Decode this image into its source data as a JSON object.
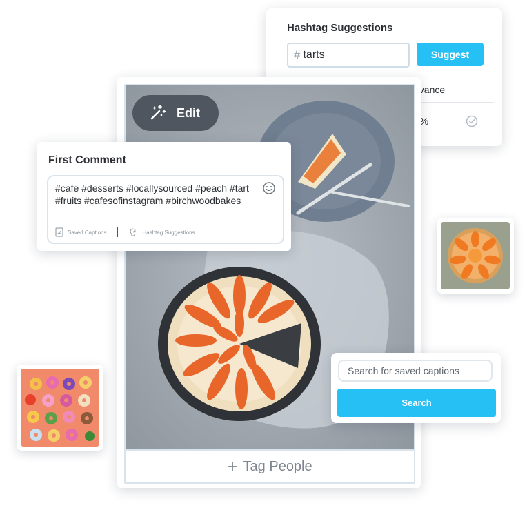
{
  "hashtag_panel": {
    "title": "Hashtag Suggestions",
    "input_value": "tarts",
    "input_prefix": "#",
    "suggest_label": "Suggest",
    "column_header_partial": "evance",
    "row_value_partial": "%"
  },
  "post": {
    "edit_label": "Edit",
    "tag_people_label": "Tag People"
  },
  "first_comment": {
    "title": "First Comment",
    "text": "#cafe #desserts #locallysourced #peach #tart #fruits #cafesofinstagram #birchwoodbakes",
    "saved_captions_label": "Saved Captions",
    "hashtag_suggestions_label": "Hashtag Suggestions"
  },
  "search_panel": {
    "placeholder": "Search for saved captions",
    "button_label": "Search"
  },
  "colors": {
    "accent": "#27c0f5",
    "edit_button": "#4f5660",
    "border": "#d9e3ec"
  }
}
